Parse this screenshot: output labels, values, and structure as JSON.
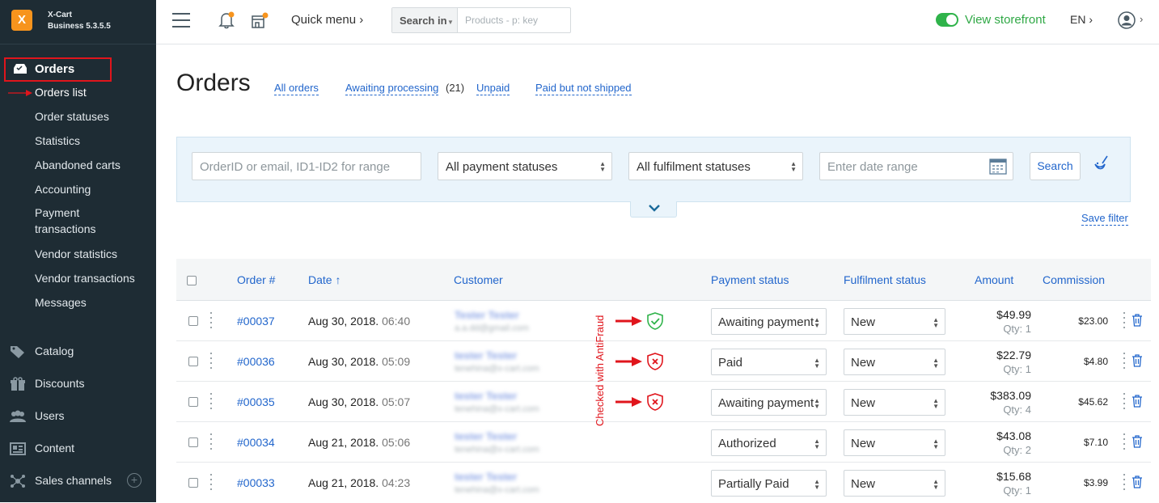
{
  "app": {
    "name": "X-Cart",
    "edition": "Business 5.3.5.5",
    "logo_glyph": "X"
  },
  "sidebar": {
    "orders_label": "Orders",
    "sub_items": [
      {
        "label": "Orders list"
      },
      {
        "label": "Order statuses"
      },
      {
        "label": "Statistics"
      },
      {
        "label": "Abandoned carts"
      },
      {
        "label": "Accounting"
      },
      {
        "label": "Payment transactions"
      },
      {
        "label": "Vendor statistics"
      },
      {
        "label": "Vendor transactions"
      },
      {
        "label": "Messages"
      }
    ],
    "main_items": [
      {
        "label": "Catalog",
        "icon": "tag-icon"
      },
      {
        "label": "Discounts",
        "icon": "gift-icon"
      },
      {
        "label": "Users",
        "icon": "users-icon"
      },
      {
        "label": "Content",
        "icon": "content-icon"
      },
      {
        "label": "Sales channels",
        "icon": "network-icon"
      }
    ],
    "plus_glyph": "+"
  },
  "topbar": {
    "quick_menu": "Quick menu ›",
    "search_in": "Search in",
    "search_placeholder": "Products - p: key",
    "view_storefront": "View storefront",
    "language": "EN ›",
    "user_caret": "›",
    "toggle_color": "#2fb34a"
  },
  "page": {
    "title": "Orders",
    "quick_links": [
      {
        "label": "All orders"
      },
      {
        "label": "Awaiting processing",
        "count": "(21)"
      },
      {
        "label": "Unpaid"
      },
      {
        "label": "Paid but not shipped"
      }
    ]
  },
  "filter": {
    "order_placeholder": "OrderID or email, ID1-ID2 for range",
    "payment_status": "All payment statuses",
    "fulfilment_status": "All fulfilment statuses",
    "date_placeholder": "Enter date range",
    "search_button": "Search",
    "save_filter": "Save filter"
  },
  "table": {
    "headers": {
      "order": "Order #",
      "date": "Date ↑",
      "customer": "Customer",
      "payment_status": "Payment status",
      "fulfilment_status": "Fulfilment status",
      "amount": "Amount",
      "commission": "Commission"
    },
    "antifraud_label": "Checked with AntiFraud",
    "rows": [
      {
        "order": "#00037",
        "date": "Aug 30, 2018.",
        "time": "06:40",
        "customer": "Tester Tester",
        "email": "a.a.dd@gmail.com",
        "shield": "ok",
        "payment": "Awaiting payment",
        "fulfilment": "New",
        "amount": "$49.99",
        "qty": "Qty: 1",
        "commission": "$23.00"
      },
      {
        "order": "#00036",
        "date": "Aug 30, 2018.",
        "time": "05:09",
        "customer": "tester Tester",
        "email": "tenehina@x-cart.com",
        "shield": "fail",
        "payment": "Paid",
        "fulfilment": "New",
        "amount": "$22.79",
        "qty": "Qty: 1",
        "commission": "$4.80"
      },
      {
        "order": "#00035",
        "date": "Aug 30, 2018.",
        "time": "05:07",
        "customer": "tester Tester",
        "email": "tenehina@x-cart.com",
        "shield": "fail",
        "payment": "Awaiting payment",
        "fulfilment": "New",
        "amount": "$383.09",
        "qty": "Qty: 4",
        "commission": "$45.62"
      },
      {
        "order": "#00034",
        "date": "Aug 21, 2018.",
        "time": "05:06",
        "customer": "tester Tester",
        "email": "tenehina@x-cart.com",
        "shield": "",
        "payment": "Authorized",
        "fulfilment": "New",
        "amount": "$43.08",
        "qty": "Qty: 2",
        "commission": "$7.10"
      },
      {
        "order": "#00033",
        "date": "Aug 21, 2018.",
        "time": "04:23",
        "customer": "tester Tester",
        "email": "tenehina@x-cart.com",
        "shield": "",
        "payment": "Partially Paid",
        "fulfilment": "New",
        "amount": "$15.68",
        "qty": "Qty: 1",
        "commission": "$3.99"
      }
    ]
  },
  "colors": {
    "accent": "#2266cc",
    "annotation_red": "#e0151c",
    "ok_green": "#2fb34a",
    "sidebar_bg": "#1e2c34"
  }
}
